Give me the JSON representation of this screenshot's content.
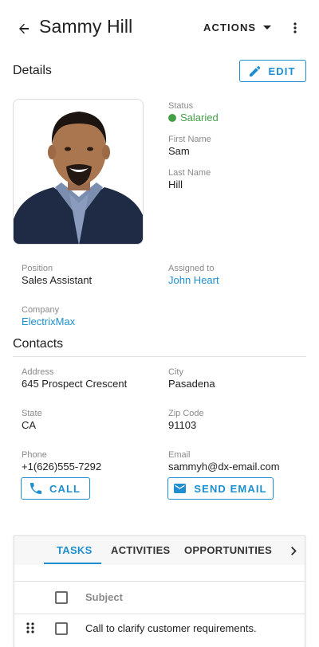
{
  "header": {
    "title": "Sammy Hill",
    "actions_label": "ACTIONS"
  },
  "details": {
    "section_title": "Details",
    "edit_label": "EDIT",
    "status_label": "Status",
    "status_value": "Salaried",
    "first_name_label": "First Name",
    "first_name_value": "Sam",
    "last_name_label": "Last Name",
    "last_name_value": "Hill",
    "position_label": "Position",
    "position_value": "Sales Assistant",
    "assigned_label": "Assigned to",
    "assigned_value": "John Heart",
    "company_label": "Company",
    "company_value": "ElectrixMax"
  },
  "contacts": {
    "section_title": "Contacts",
    "address_label": "Address",
    "address_value": "645 Prospect Crescent",
    "city_label": "City",
    "city_value": "Pasadena",
    "state_label": "State",
    "state_value": "CA",
    "zip_label": "Zip Code",
    "zip_value": "91103",
    "phone_label": "Phone",
    "phone_value": "+1(626)555-7292",
    "email_label": "Email",
    "email_value": "sammyh@dx-email.com",
    "call_label": "CALL",
    "send_email_label": "SEND EMAIL"
  },
  "tabs": {
    "items": [
      "TASKS",
      "ACTIVITIES",
      "OPPORTUNITIES"
    ],
    "active": "TASKS"
  },
  "tasks_table": {
    "columns": [
      "Subject"
    ],
    "rows": [
      {
        "subject": "Call to clarify customer requirements."
      }
    ]
  },
  "colors": {
    "accent": "#1d8ecf",
    "status_green": "#43a047"
  },
  "icons": [
    "back-arrow-icon",
    "caret-down-icon",
    "more-vertical-icon",
    "pencil-icon",
    "phone-icon",
    "envelope-icon",
    "chevron-right-icon",
    "drag-handle-icon"
  ]
}
